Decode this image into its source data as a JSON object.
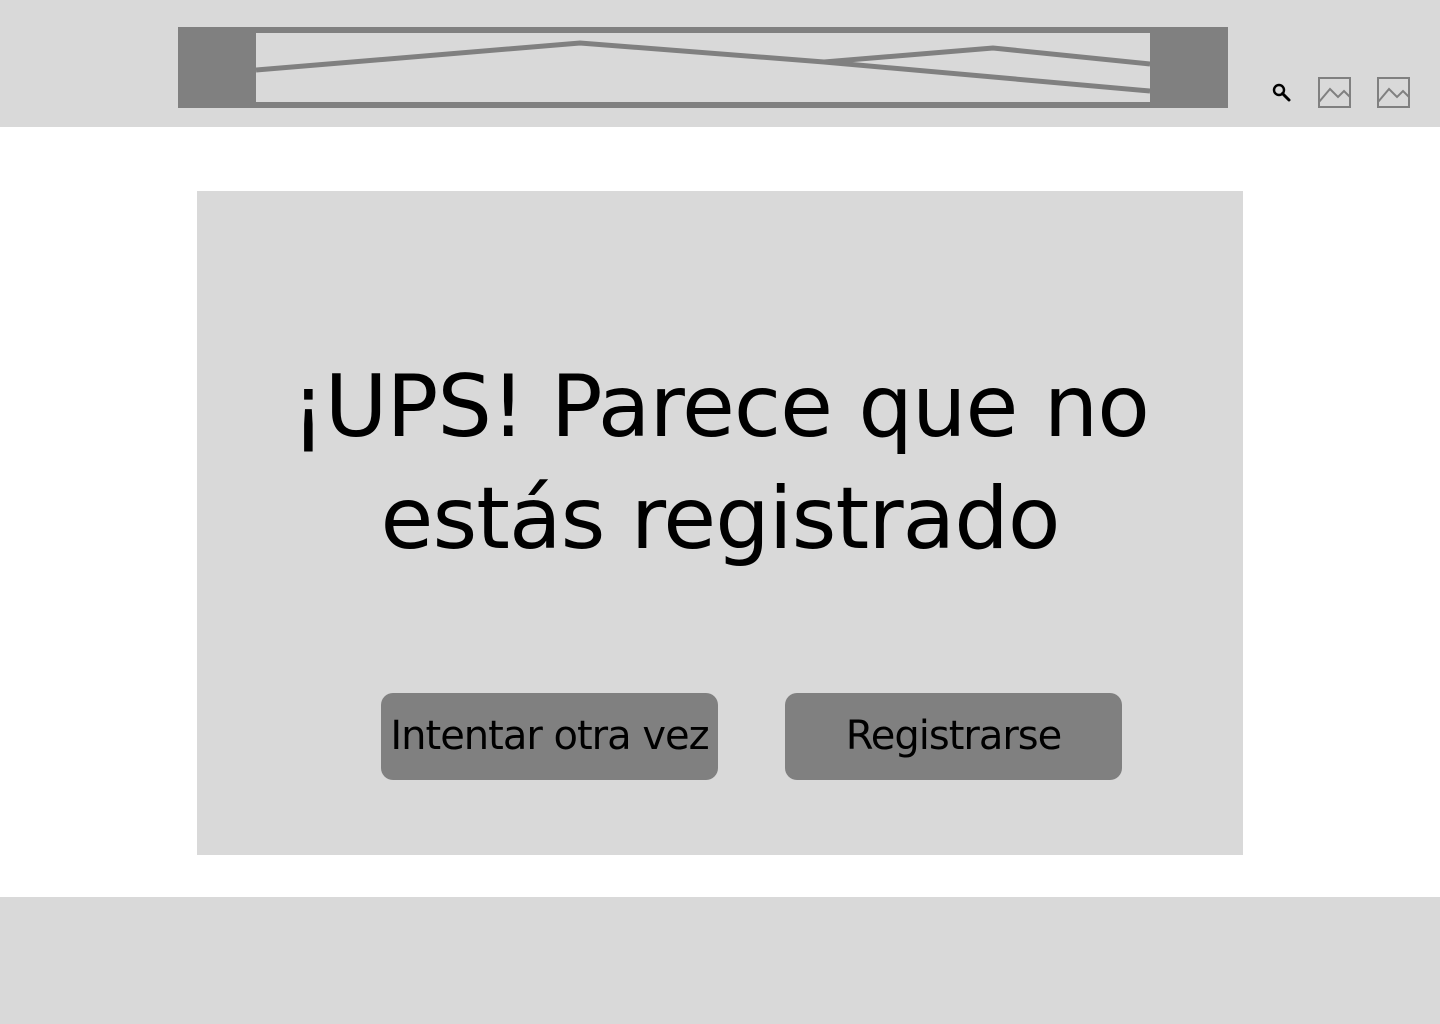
{
  "header": {
    "banner_icon": "image-placeholder",
    "icons": [
      "search-icon",
      "image-icon",
      "image-icon"
    ]
  },
  "main": {
    "headline_line1": "¡UPS! Parece que no",
    "headline_line2": "estás registrado",
    "retry_label": "Intentar otra vez",
    "register_label": "Registrarse"
  },
  "colors": {
    "bar_background": "#d9d9d9",
    "placeholder_dark": "#808080",
    "page_background": "#ffffff",
    "text": "#000000"
  }
}
